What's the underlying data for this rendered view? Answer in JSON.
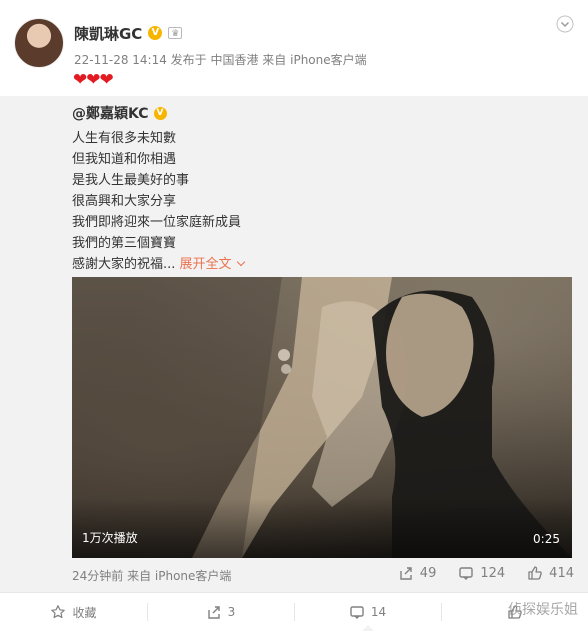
{
  "post": {
    "author": "陳凱琳GC",
    "meta": "22-11-28 14:14 发布于 中国香港 来自 iPhone客户端",
    "text": "❤❤❤"
  },
  "repost": {
    "author": "@鄭嘉穎KC",
    "lines": [
      "人生有很多未知數",
      "但我知道和你相遇",
      "是我人生最美好的事",
      "很高興和大家分享",
      "我們即將迎來一位家庭新成員",
      "我們的第三個寶寶"
    ],
    "last_line": "感謝大家的祝福...",
    "expand": "展开全文",
    "video": {
      "play_count": "1万次播放",
      "duration": "0:25"
    },
    "time": "24分钟前 来自 iPhone客户端",
    "stats": {
      "reposts": "49",
      "comments": "124",
      "likes": "414"
    }
  },
  "actions": {
    "favorite": "收藏",
    "repost": "3",
    "comment": "14"
  },
  "watermark": "侦探娱乐姐",
  "colors": {
    "link": "#eb7350",
    "heart": "#e21b23",
    "verified": "#f7b500",
    "muted": "#808080"
  }
}
